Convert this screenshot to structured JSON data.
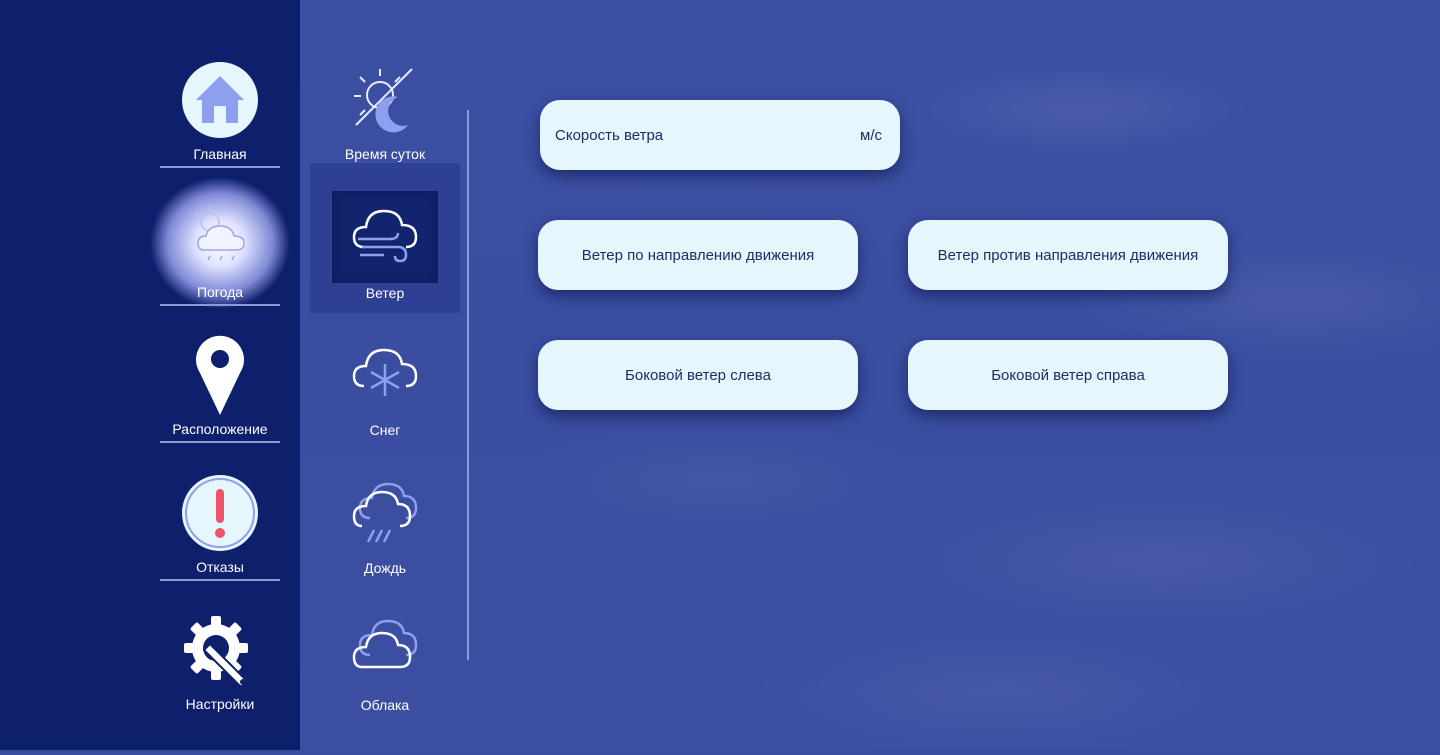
{
  "sidebar": {
    "items": [
      {
        "label": "Главная",
        "icon": "home-icon"
      },
      {
        "label": "Погода",
        "icon": "weather-icon"
      },
      {
        "label": "Расположение",
        "icon": "location-pin-icon"
      },
      {
        "label": "Отказы",
        "icon": "alert-icon"
      },
      {
        "label": "Настройки",
        "icon": "settings-wrench-icon"
      }
    ],
    "active": "Погода"
  },
  "submenu": {
    "items": [
      {
        "label": "Время суток",
        "icon": "day-night-icon"
      },
      {
        "label": "Ветер",
        "icon": "wind-cloud-icon"
      },
      {
        "label": "Снег",
        "icon": "snow-cloud-icon"
      },
      {
        "label": "Дождь",
        "icon": "rain-cloud-icon"
      },
      {
        "label": "Облака",
        "icon": "clouds-icon"
      }
    ],
    "active": "Ветер"
  },
  "wind": {
    "speed_label": "Скорость ветра",
    "speed_unit": "м/с",
    "tailwind": "Ветер по направлению движения",
    "headwind": "Ветер против направления движения",
    "crosswind_left": "Боковой ветер слева",
    "crosswind_right": "Боковой ветер справа"
  },
  "colors": {
    "sidebar_bg": "#0e1f6c",
    "content_bg": "#3a4c9f",
    "button_bg": "#e6f6fd",
    "icon_light": "#8f9ff0",
    "alert_red": "#f0546a"
  }
}
